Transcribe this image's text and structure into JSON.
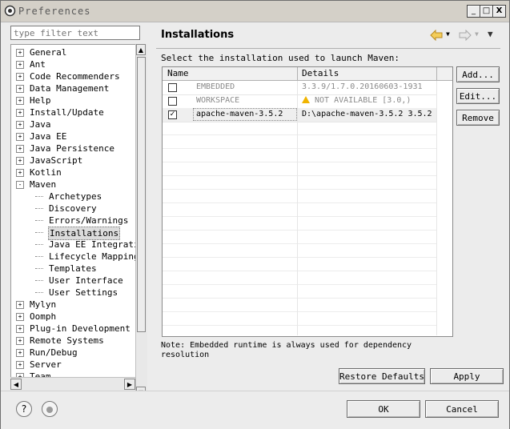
{
  "window": {
    "title": "Preferences",
    "controls": [
      "_",
      "□",
      "X"
    ]
  },
  "filter": {
    "placeholder": "type filter text"
  },
  "tree": {
    "items": [
      {
        "label": "General",
        "level": 0,
        "expander": "+"
      },
      {
        "label": "Ant",
        "level": 0,
        "expander": "+"
      },
      {
        "label": "Code Recommenders",
        "level": 0,
        "expander": "+"
      },
      {
        "label": "Data Management",
        "level": 0,
        "expander": "+"
      },
      {
        "label": "Help",
        "level": 0,
        "expander": "+"
      },
      {
        "label": "Install/Update",
        "level": 0,
        "expander": "+"
      },
      {
        "label": "Java",
        "level": 0,
        "expander": "+"
      },
      {
        "label": "Java EE",
        "level": 0,
        "expander": "+"
      },
      {
        "label": "Java Persistence",
        "level": 0,
        "expander": "+"
      },
      {
        "label": "JavaScript",
        "level": 0,
        "expander": "+"
      },
      {
        "label": "Kotlin",
        "level": 0,
        "expander": "+"
      },
      {
        "label": "Maven",
        "level": 0,
        "expander": "-"
      },
      {
        "label": "Archetypes",
        "level": 1
      },
      {
        "label": "Discovery",
        "level": 1
      },
      {
        "label": "Errors/Warnings",
        "level": 1
      },
      {
        "label": "Installations",
        "level": 1,
        "selected": true
      },
      {
        "label": "Java EE Integratio",
        "level": 1
      },
      {
        "label": "Lifecycle Mappings",
        "level": 1
      },
      {
        "label": "Templates",
        "level": 1
      },
      {
        "label": "User Interface",
        "level": 1
      },
      {
        "label": "User Settings",
        "level": 1
      },
      {
        "label": "Mylyn",
        "level": 0,
        "expander": "+"
      },
      {
        "label": "Oomph",
        "level": 0,
        "expander": "+"
      },
      {
        "label": "Plug-in Development",
        "level": 0,
        "expander": "+"
      },
      {
        "label": "Remote Systems",
        "level": 0,
        "expander": "+"
      },
      {
        "label": "Run/Debug",
        "level": 0,
        "expander": "+"
      },
      {
        "label": "Server",
        "level": 0,
        "expander": "+"
      },
      {
        "label": "Team",
        "level": 0,
        "expander": "+"
      }
    ]
  },
  "page": {
    "title": "Installations",
    "instruction": "Select the installation used to launch Maven:",
    "columns": [
      "Name",
      "Details"
    ],
    "rows": [
      {
        "checked": false,
        "name": "EMBEDDED",
        "details": "3.3.9/1.7.0.20160603-1931",
        "grayed": true,
        "warning": false
      },
      {
        "checked": false,
        "name": "WORKSPACE",
        "details": "NOT AVAILABLE [3.0,)",
        "grayed": true,
        "warning": true
      },
      {
        "checked": true,
        "name": "apache-maven-3.5.2",
        "details": "D:\\apache-maven-3.5.2 3.5.2",
        "grayed": false,
        "warning": false
      }
    ],
    "note": "Note: Embedded runtime is always used for dependency resolution",
    "buttons": {
      "add": "Add...",
      "edit": "Edit...",
      "remove": "Remove"
    },
    "restore_defaults": "Restore Defaults",
    "apply": "Apply"
  },
  "footer": {
    "ok": "OK",
    "cancel": "Cancel",
    "help_icon": "?"
  },
  "colors": {
    "warning": "#f0b400",
    "nav_arrow": "#e8b020"
  }
}
